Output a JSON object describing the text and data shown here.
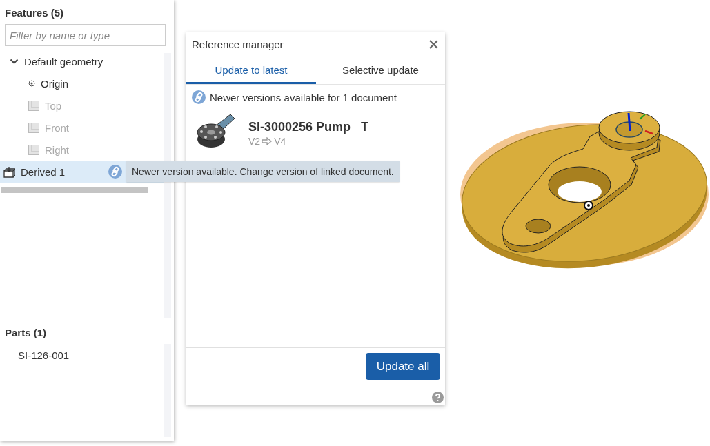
{
  "features_panel": {
    "title": "Features (5)",
    "filter": {
      "placeholder": "Filter by name or type"
    },
    "tree": [
      {
        "label": "Default geometry",
        "kind": "group",
        "expanded": true,
        "hidden": false,
        "selected": false,
        "children": [
          {
            "label": "Origin",
            "kind": "origin",
            "hidden": false,
            "selected": false
          },
          {
            "label": "Top",
            "kind": "plane",
            "hidden": true,
            "selected": false
          },
          {
            "label": "Front",
            "kind": "plane",
            "hidden": true,
            "selected": false
          },
          {
            "label": "Right",
            "kind": "plane",
            "hidden": true,
            "selected": false
          }
        ]
      },
      {
        "label": "Derived 1",
        "kind": "derived",
        "hidden": false,
        "selected": true,
        "linked": true,
        "tooltip": "Newer version available. Change version of linked document."
      }
    ]
  },
  "parts_panel": {
    "title": "Parts (1)",
    "items": [
      {
        "label": "SI-126-001"
      }
    ]
  },
  "reference_manager": {
    "title": "Reference manager",
    "tabs": [
      {
        "label": "Update to latest",
        "selected": true
      },
      {
        "label": "Selective update",
        "selected": false
      }
    ],
    "notice": "Newer versions available for 1 document",
    "documents": [
      {
        "name": "SI-3000256 Pump _T",
        "from_version": "V2",
        "to_version": "V4"
      }
    ],
    "button": "Update all"
  }
}
